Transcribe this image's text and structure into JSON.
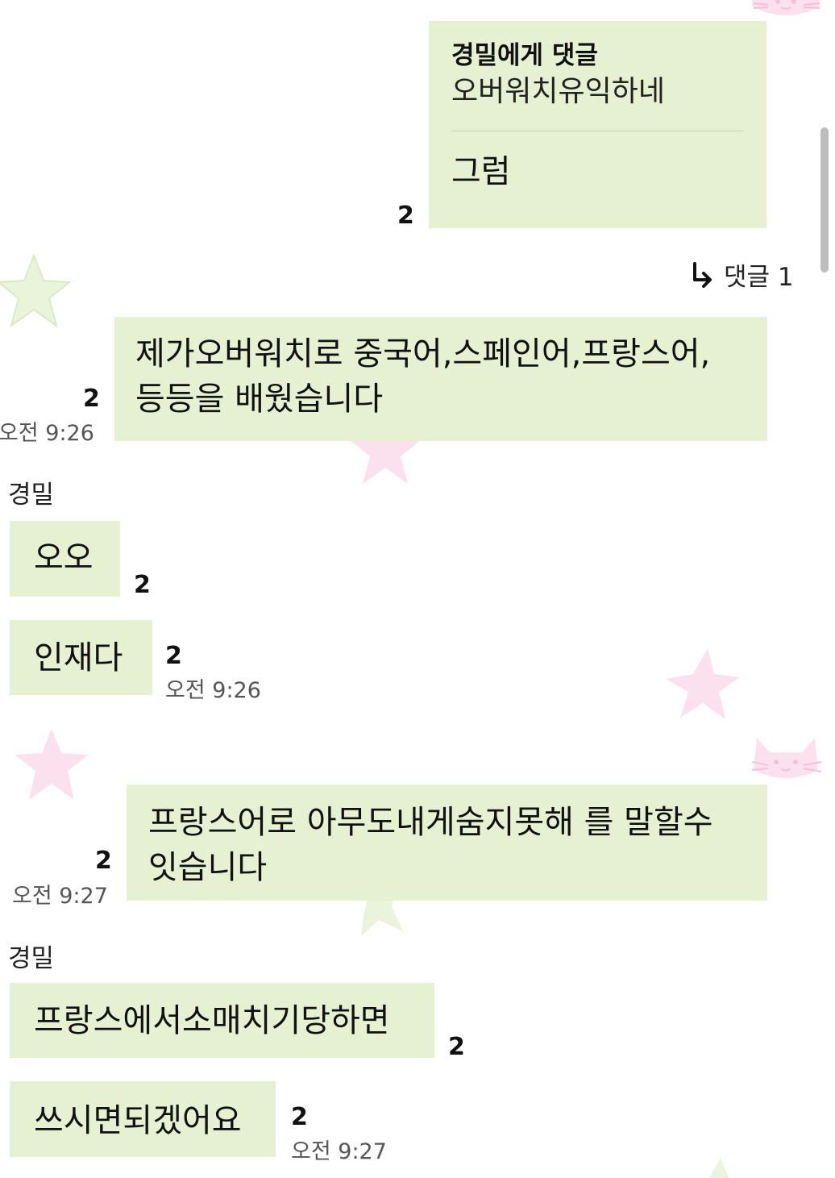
{
  "messages": {
    "m1": {
      "reply_to_title": "경밀에게 댓글",
      "reply_to_quote": "오버워치유익하네",
      "text": "그럼",
      "unread": "2"
    },
    "thread": {
      "icon": "reply-arrow-icon",
      "label": "댓글 1"
    },
    "m2": {
      "lines": [
        "제가오버워치로 중국어,스페인어,프랑스어,",
        "등등을 배웠습니다"
      ],
      "unread": "2",
      "time": "오전 9:26"
    },
    "sender1": "경밀",
    "m3": {
      "text": "오오",
      "unread": "2"
    },
    "m4": {
      "text": "인재다",
      "unread": "2",
      "time": "오전 9:26"
    },
    "m5": {
      "lines": [
        "프랑스어로 아무도내게숨지못해 를 말할수",
        "잇습니다"
      ],
      "unread": "2",
      "time": "오전 9:27"
    },
    "sender2": "경밀",
    "m6": {
      "text": "프랑스에서소매치기당하면",
      "unread": "2"
    },
    "m7": {
      "text": "쓰시면되겠어요",
      "unread": "2",
      "time": "오전 9:27"
    }
  },
  "colors": {
    "bubble": "#e6f1d2",
    "star_green": "#eaf4da",
    "star_pink": "#fbe1ee",
    "cat_pink": "#f6bfd8"
  }
}
